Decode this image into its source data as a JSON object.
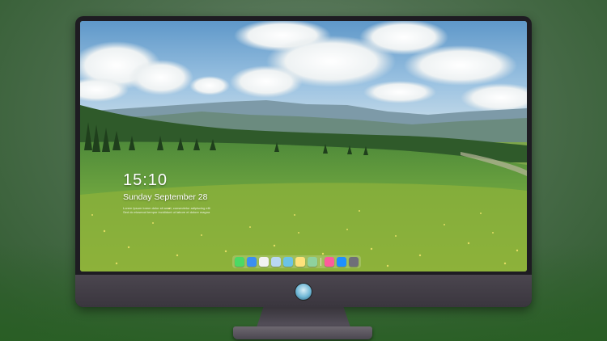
{
  "lock_screen": {
    "time": "15:10",
    "date": "Sunday September 28",
    "notice_line1": "Lorem Ipsum lorem dolor sit amet, consectetur adipiscing elit",
    "notice_line2": "Sed do eiusmod tempor incididunt ut labore et dolore magna"
  },
  "dock": {
    "items": [
      {
        "name": "messages-icon",
        "color": "#4cd964"
      },
      {
        "name": "finder-icon",
        "color": "#3b8ff0"
      },
      {
        "name": "safari-icon",
        "color": "#f2f2f2"
      },
      {
        "name": "preview-icon",
        "color": "#b9d7f2"
      },
      {
        "name": "claquette-icon",
        "color": "#6cc3e6"
      },
      {
        "name": "notes-icon",
        "color": "#ffe27a"
      },
      {
        "name": "photos-icon",
        "color": "#8fd19e"
      },
      {
        "name": "music-icon",
        "color": "#fc5c9c"
      },
      {
        "name": "app-store-icon",
        "color": "#1e90ff"
      },
      {
        "name": "screenshot-icon",
        "color": "#6f6f78"
      }
    ]
  },
  "colors": {
    "bezel": "#1e1c22",
    "chin": "#46414a",
    "sky": "#7fb0d9",
    "grass": "#6da23f"
  }
}
